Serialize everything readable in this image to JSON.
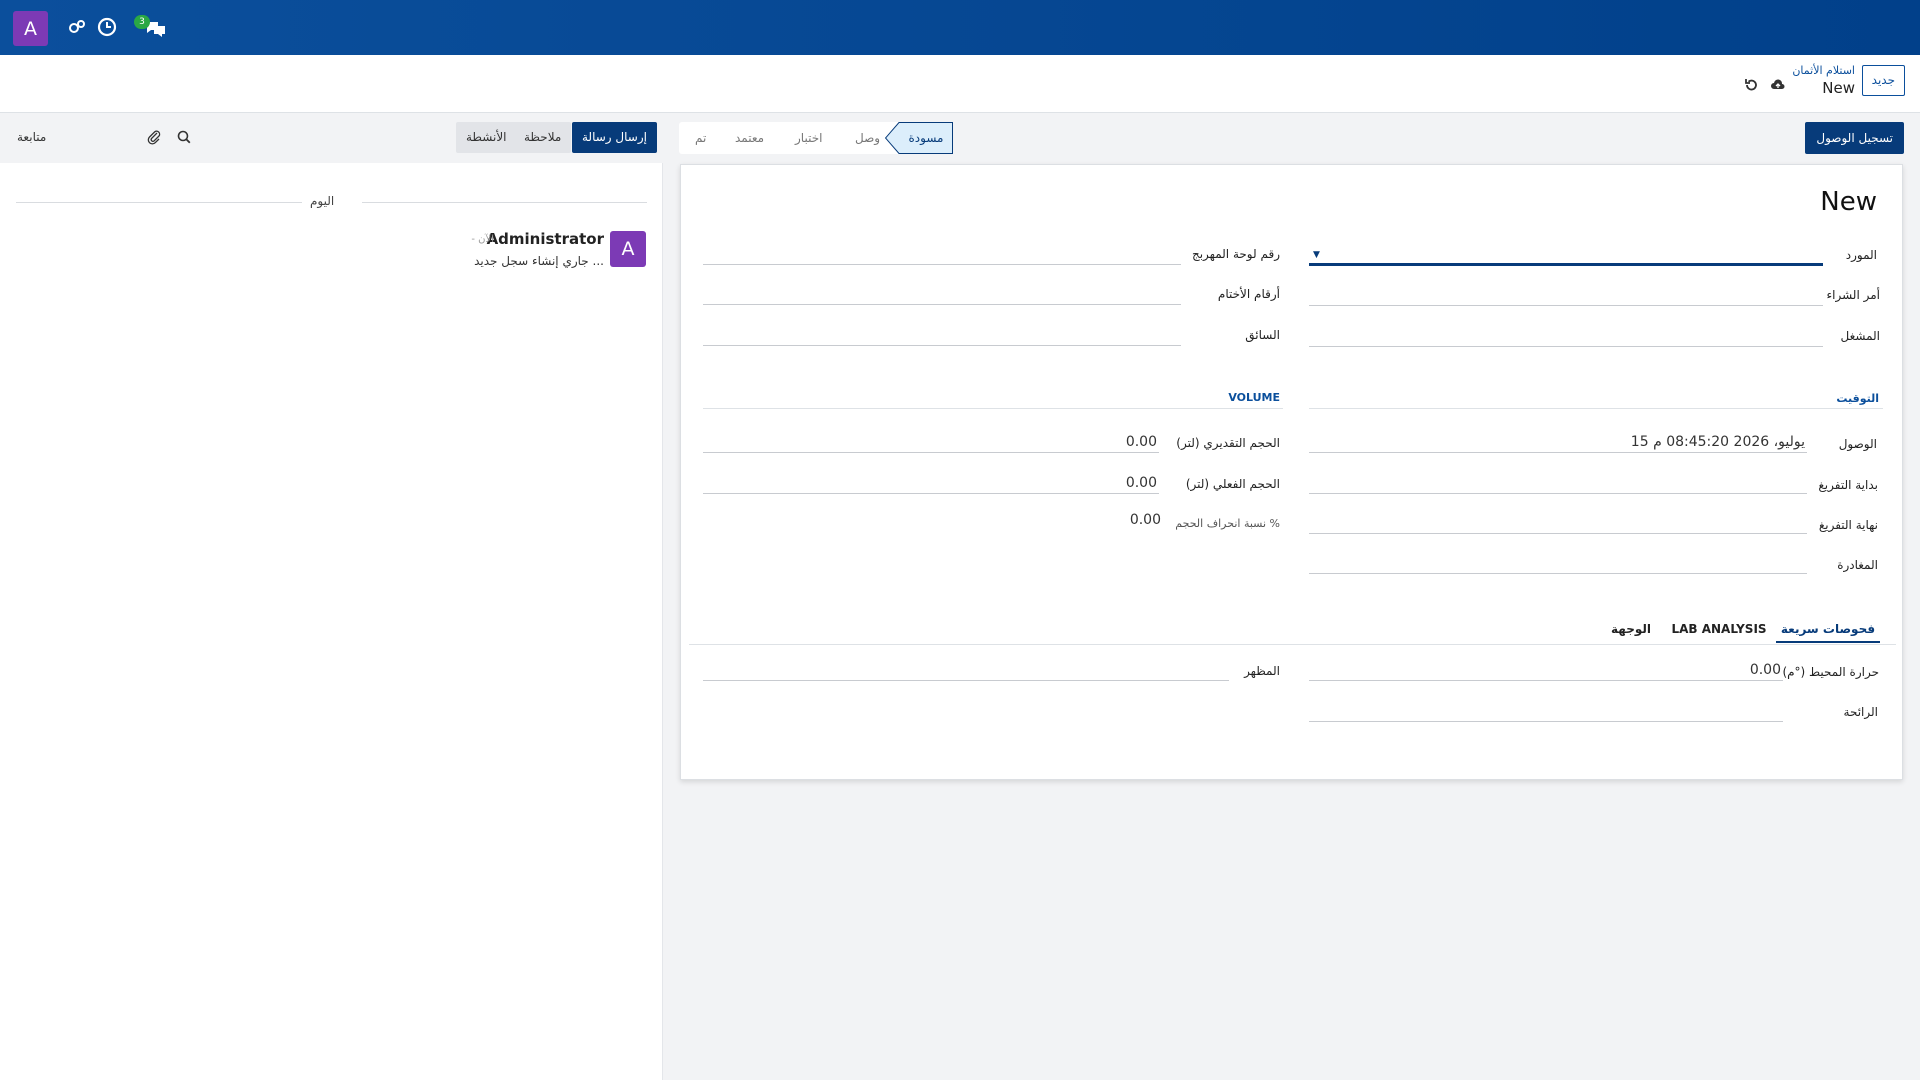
{
  "topbar": {
    "user_initial": "A",
    "messages_count": "3"
  },
  "control": {
    "new_label": "جديد",
    "breadcrumb_parent": "استلام الأثمان",
    "breadcrumb_current": "New"
  },
  "status": {
    "checkin_label": "تسجيل الوصول",
    "stages": [
      "مسودة",
      "وصل",
      "اختبار",
      "معتمد",
      "تم"
    ],
    "active_stage": "مسودة"
  },
  "form": {
    "title": "New",
    "supplier_label": "المورد",
    "supplier_value": "",
    "po_label": "أمر الشراء",
    "operator_label": "المشغل",
    "tanker_label": "رقم لوحة المهربج",
    "seals_label": "أرقام الأختام",
    "driver_label": "السائق",
    "timing_title": "التوقيت",
    "volume_title": "VOLUME",
    "arrival_label": "الوصول",
    "arrival_value": "15 يوليو، 2026 08:45:20 م",
    "unload_start_label": "بداية التفريغ",
    "unload_end_label": "نهاية التفريغ",
    "departure_label": "المغادرة",
    "est_volume_label": "الحجم التقديري (لتر)",
    "est_volume_value": "0.00",
    "act_volume_label": "الحجم الفعلي (لتر)",
    "act_volume_value": "0.00",
    "dev_label": "نسبة انحراف الحجم %",
    "dev_value": "0.00",
    "tabs": [
      "فحوصات سريعة",
      "LAB ANALYSIS",
      "الوجهة"
    ],
    "active_tab": "فحوصات سريعة",
    "ambient_label": "حرارة المحيط (°م)",
    "ambient_value": "0.00",
    "smell_label": "الرائحة",
    "appearance_label": "المظهر"
  },
  "chatter": {
    "send_label": "إرسال رسالة",
    "note_label": "ملاحظة",
    "activities_label": "الأنشطة",
    "follow_label": "متابعة",
    "today_label": "اليوم",
    "message": {
      "avatar_initial": "A",
      "author": "Administrator",
      "time": "- الآن",
      "body": "جاري إنشاء سجل جديد ..."
    }
  },
  "colors": {
    "brand": "#0b4f9c",
    "avatar": "#7c3ab5",
    "badge": "#2aa845"
  }
}
